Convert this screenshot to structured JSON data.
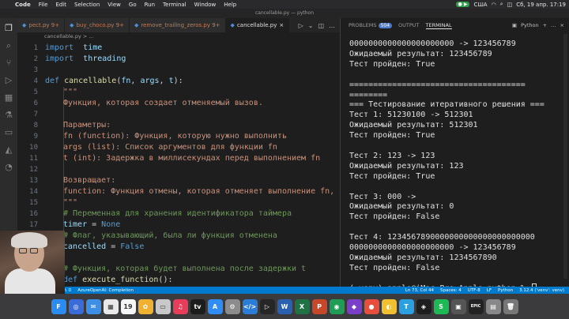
{
  "menubar": {
    "app": "Code",
    "items": [
      "File",
      "Edit",
      "Selection",
      "View",
      "Go",
      "Run",
      "Terminal",
      "Window",
      "Help"
    ],
    "keyboard": "США",
    "datetime": "Сб, 19 апр.  17:19"
  },
  "window_title": "cancellable.py — python",
  "tabs": [
    {
      "label": "pect.py  9+"
    },
    {
      "label": "buy_choco.py  9+"
    },
    {
      "label": "remove_trailing_zeros.py  9+"
    },
    {
      "label": "cancellable.py",
      "active": true
    }
  ],
  "breadcrumb": "cancellable.py > ...",
  "editor_lines": [
    {
      "n": "1",
      "segs": [
        [
          "kw",
          "import"
        ],
        [
          "",
          "  "
        ],
        [
          "var",
          "time"
        ]
      ]
    },
    {
      "n": "2",
      "segs": [
        [
          "kw",
          "import"
        ],
        [
          "",
          "  "
        ],
        [
          "var",
          "threading"
        ]
      ]
    },
    {
      "n": "3",
      "segs": []
    },
    {
      "n": "4",
      "segs": [
        [
          "kw",
          "def"
        ],
        [
          "",
          " "
        ],
        [
          "fn",
          "cancellable"
        ],
        [
          "",
          "("
        ],
        [
          "var",
          "fn"
        ],
        [
          "",
          ", "
        ],
        [
          "var",
          "args"
        ],
        [
          "",
          ", "
        ],
        [
          "var",
          "t"
        ],
        [
          "",
          "):"
        ]
      ]
    },
    {
      "n": "5",
      "indent": true,
      "segs": [
        [
          "str",
          "\"\"\""
        ]
      ]
    },
    {
      "n": "6",
      "indent": true,
      "segs": [
        [
          "str",
          "Функция, которая создает отменяемый вызов."
        ]
      ]
    },
    {
      "n": "7",
      "segs": []
    },
    {
      "n": "8",
      "indent": true,
      "segs": [
        [
          "str",
          "Параметры:"
        ]
      ]
    },
    {
      "n": "9",
      "indent": true,
      "segs": [
        [
          "str",
          "fn (function): Функция, которую нужно выполнить"
        ]
      ]
    },
    {
      "n": "10",
      "indent": true,
      "segs": [
        [
          "str",
          "args (list): Список аргументов для функции fn"
        ]
      ]
    },
    {
      "n": "11",
      "indent": true,
      "segs": [
        [
          "str",
          "t (int): Задержка в миллисекундах перед выполнением fn"
        ]
      ]
    },
    {
      "n": "12",
      "segs": []
    },
    {
      "n": "13",
      "indent": true,
      "segs": [
        [
          "str",
          "Возвращает:"
        ]
      ]
    },
    {
      "n": "14",
      "indent": true,
      "segs": [
        [
          "str",
          "function: Функция отмены, которая отменяет выполнение fn, ес"
        ]
      ]
    },
    {
      "n": "15",
      "indent": true,
      "segs": [
        [
          "str",
          "\"\"\""
        ]
      ]
    },
    {
      "n": "16",
      "indent": true,
      "segs": [
        [
          "cm",
          "# Переменная для хранения идентификатора таймера"
        ]
      ]
    },
    {
      "n": "17",
      "indent": true,
      "segs": [
        [
          "var",
          "timer"
        ],
        [
          "",
          " = "
        ],
        [
          "kw",
          "None"
        ]
      ]
    },
    {
      "n": "18",
      "indent": true,
      "segs": [
        [
          "cm",
          "# Флаг, указывающий, была ли функция отменена"
        ]
      ]
    },
    {
      "n": "19",
      "indent": true,
      "segs": [
        [
          "var",
          "cancelled"
        ],
        [
          "",
          " = "
        ],
        [
          "kw",
          "False"
        ]
      ]
    },
    {
      "n": "20",
      "segs": []
    },
    {
      "n": "21",
      "indent": true,
      "segs": [
        [
          "cm",
          "# Функция, которая будет выполнена после задержки t"
        ]
      ]
    },
    {
      "n": "22",
      "indent": true,
      "segs": [
        [
          "kw",
          "def"
        ],
        [
          "",
          " "
        ],
        [
          "fn",
          "execute_function"
        ],
        [
          "",
          "():"
        ]
      ]
    }
  ],
  "panel_tabs": {
    "problems": "PROBLEMS",
    "problems_count": "504",
    "output": "OUTPUT",
    "terminal": "TERMINAL",
    "shell": "Python"
  },
  "terminal_lines": [
    "0000000000000000000000 -> 123456789",
    "Ожидаемый результат: 123456789",
    "Тест пройден: True",
    "",
    "=====================================",
    "========",
    "=== Тестирование итеративного решения ===",
    "Тест 1: 51230100 -> 512301",
    "Ожидаемый результат: 512301",
    "Тест пройден: True",
    "",
    "Тест 2: 123 -> 123",
    "Ожидаемый результат: 123",
    "Тест пройден: True",
    "",
    "Тест 3: 000 -> ",
    "Ожидаемый результат: 0",
    "Тест пройден: False",
    "",
    "Тест 4: 1234567890000000000000000000000",
    "0000000000000000000000 -> 123456789",
    "Ожидаемый результат: 1234567890",
    "Тест пройден: False",
    "",
    "(.venv) apple@iMac-Pro-Apple python % "
  ],
  "statusbar": {
    "left": "⚠ 0",
    "center": "AzureOpenAI: Completion",
    "position": "Ln 73, Col 44",
    "spaces": "Spaces: 4",
    "encoding": "UTF-8",
    "eol": "LF",
    "lang": "Python",
    "interpreter": "3.12.4 ('venv': venv)"
  },
  "dock": [
    {
      "label": "F",
      "color": "#2a8cf0"
    },
    {
      "label": "◎",
      "color": "#3a6bd8"
    },
    {
      "label": "✉",
      "color": "#3d8fe6"
    },
    {
      "label": "▦",
      "color": "#e8e8e8"
    },
    {
      "label": "19",
      "color": "#f5f5f5"
    },
    {
      "label": "✿",
      "color": "#f0b030"
    },
    {
      "label": "▭",
      "color": "#c8c8c8"
    },
    {
      "label": "♫",
      "color": "#e63d5a"
    },
    {
      "label": "tv",
      "color": "#1c1c1c"
    },
    {
      "label": "A",
      "color": "#2f8df5"
    },
    {
      "label": "⚙",
      "color": "#8c8c8c"
    },
    {
      "label": "</>",
      "color": "#2c7dd8"
    },
    {
      "label": "▷",
      "color": "#262626"
    },
    {
      "label": "W",
      "color": "#2b5faf"
    },
    {
      "label": "X",
      "color": "#207245"
    },
    {
      "label": "P",
      "color": "#c7472b"
    },
    {
      "label": "◉",
      "color": "#1f9d55"
    },
    {
      "label": "◆",
      "color": "#7a3fc8"
    },
    {
      "label": "●",
      "color": "#e84e3c"
    },
    {
      "label": "◐",
      "color": "#f0c030"
    },
    {
      "label": "T",
      "color": "#2aa0e0"
    },
    {
      "label": "◈",
      "color": "#1e1e1e"
    },
    {
      "label": "S",
      "color": "#1db954"
    },
    {
      "label": "▣",
      "color": "#555"
    },
    {
      "label": "EPIC",
      "color": "#222"
    },
    {
      "label": "▤",
      "color": "#888"
    },
    {
      "label": "🗑",
      "color": "#777"
    }
  ]
}
